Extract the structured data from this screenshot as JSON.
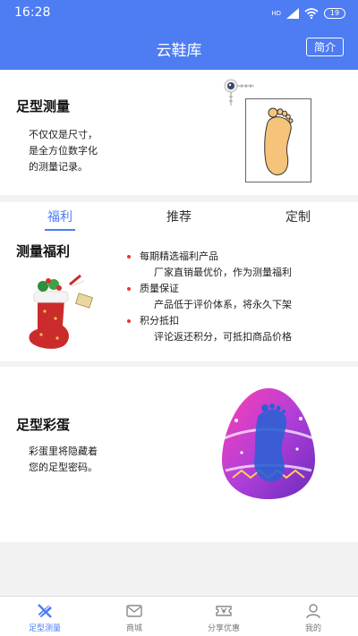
{
  "status": {
    "time": "16:28",
    "network": "HD",
    "battery": "19"
  },
  "header": {
    "title": "云鞋库",
    "intro_button": "简介"
  },
  "measure": {
    "title": "足型测量",
    "lines": [
      "不仅仅是尺寸，",
      "是全方位数字化",
      "的测量记录。"
    ]
  },
  "tabs": [
    {
      "label": "福利"
    },
    {
      "label": "推荐"
    },
    {
      "label": "定制"
    }
  ],
  "benefit": {
    "title": "测量福利",
    "items": [
      {
        "title": "每期精选福利产品",
        "desc": "厂家直销最优价，作为测量福利"
      },
      {
        "title": "质量保证",
        "desc": "产品低于评价体系，将永久下架"
      },
      {
        "title": "积分抵扣",
        "desc": "评论返还积分，可抵扣商品价格"
      }
    ]
  },
  "egg": {
    "title": "足型彩蛋",
    "lines": [
      "彩蛋里将隐藏着",
      "您的足型密码。"
    ]
  },
  "tabbar": [
    {
      "label": "足型测量"
    },
    {
      "label": "商城"
    },
    {
      "label": "分享优惠"
    },
    {
      "label": "我的"
    }
  ],
  "colors": {
    "primary": "#4d7cf3",
    "bullet": "#e53935",
    "foot": "#f5c37a"
  }
}
